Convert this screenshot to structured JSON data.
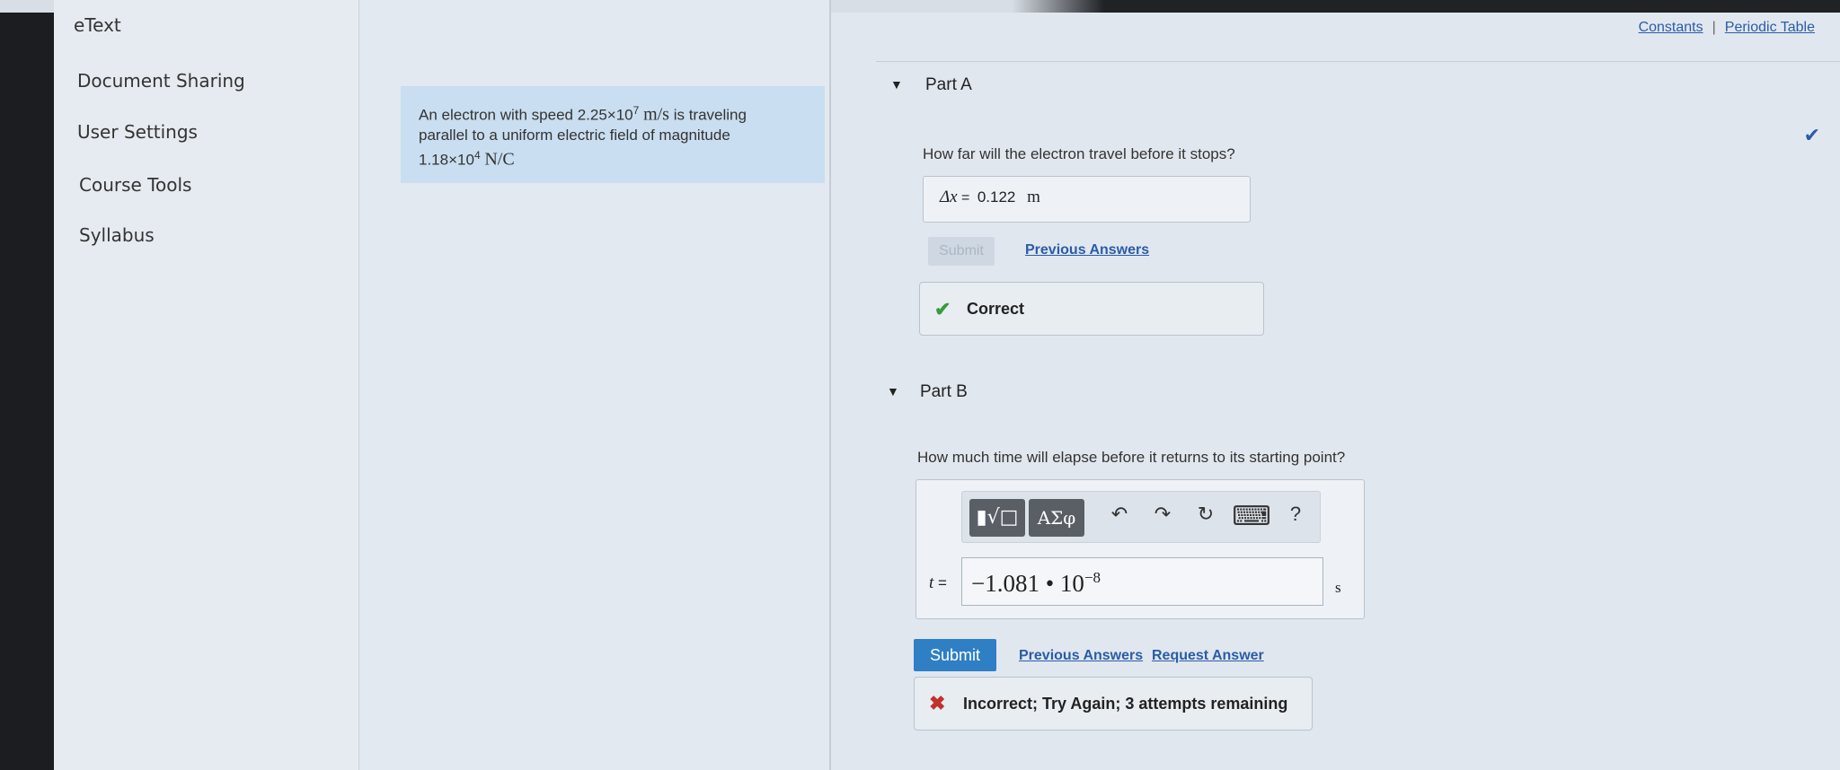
{
  "browser": {
    "url_fragment": "https://www.nepsib..."
  },
  "sidebar": {
    "items": [
      {
        "label": "eText"
      },
      {
        "label": "Document Sharing"
      },
      {
        "label": "User Settings"
      },
      {
        "label": "Course Tools"
      },
      {
        "label": "Syllabus"
      }
    ]
  },
  "problem": {
    "line1_prefix": "An electron with speed 2.25×10",
    "line1_exp": "7",
    "line1_unit": "m/s",
    "line1_suffix": " is traveling",
    "line2": "parallel to a uniform electric field of magnitude",
    "line3_prefix": "1.18×10",
    "line3_exp": "4",
    "line3_unit": "N/C"
  },
  "top_links": {
    "constants": "Constants",
    "separator": "|",
    "periodic_table": "Periodic Table"
  },
  "partA": {
    "title": "Part A",
    "question": "How far will the electron travel before it stops?",
    "answer_var": "Δx",
    "answer_eq": " = ",
    "answer_value": "0.122",
    "answer_unit": "m",
    "submit_label": "Submit",
    "previous_answers": "Previous Answers",
    "feedback": "Correct",
    "check_mark": "✔"
  },
  "partB": {
    "title": "Part B",
    "question": "How much time will elapse before it returns to its starting point?",
    "toolbar": {
      "templates_label": "▮√□",
      "greek_label": "ΑΣφ",
      "undo_icon": "↶",
      "redo_icon": "↷",
      "reset_icon": "↻",
      "keyboard_icon": "⌨",
      "help_label": "?"
    },
    "answer_var": "t",
    "answer_eq": " =",
    "answer_value": "−1.081 • 10",
    "answer_exp": "−8",
    "answer_unit": "s",
    "submit_label": "Submit",
    "previous_answers": "Previous Answers",
    "request_answer": "Request Answer",
    "feedback": "Incorrect; Try Again; 3 attempts remaining",
    "x_mark": "✖"
  },
  "colors": {
    "accent": "#2f7fc5",
    "correct": "#3a9a3a",
    "incorrect": "#c0322b",
    "link": "#2a5ca8"
  }
}
